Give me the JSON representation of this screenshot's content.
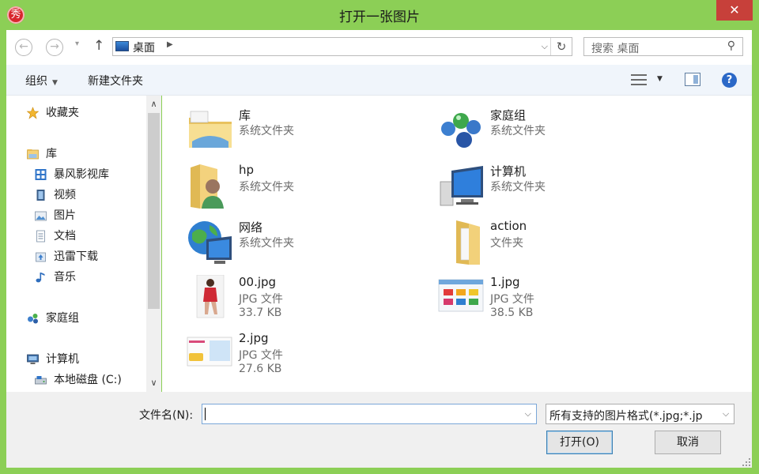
{
  "window": {
    "title": "打开一张图片",
    "close_glyph": "✕",
    "app_icon_glyph": "秀",
    "accent": "#8ccf56"
  },
  "nav": {
    "back": "←",
    "forward": "→",
    "history": "▾",
    "up": "↑",
    "address": "桌面",
    "address_sep": "▶",
    "address_drop": "⌵",
    "refresh": "↻",
    "search_placeholder": "搜索 桌面",
    "search_icon": "⚲"
  },
  "toolbar": {
    "organize": "组织",
    "organize_arrow": "▼",
    "new_folder": "新建文件夹",
    "view_arrow": "▼",
    "help": "?"
  },
  "sidebar": {
    "favorites": "收藏夹",
    "library": "库",
    "library_items": [
      "暴风影视库",
      "视频",
      "图片",
      "文档",
      "迅雷下载",
      "音乐"
    ],
    "homegroup": "家庭组",
    "computer": "计算机",
    "computer_items": [
      "本地磁盘 (C:)"
    ],
    "scroll_up": "∧",
    "scroll_down": "∨"
  },
  "items": [
    {
      "name": "库",
      "line2": "系统文件夹",
      "line3": "",
      "icon": "library-icon"
    },
    {
      "name": "家庭组",
      "line2": "系统文件夹",
      "line3": "",
      "icon": "homegroup-icon"
    },
    {
      "name": "hp",
      "line2": "系统文件夹",
      "line3": "",
      "icon": "user-folder-icon"
    },
    {
      "name": "计算机",
      "line2": "系统文件夹",
      "line3": "",
      "icon": "computer-icon"
    },
    {
      "name": "网络",
      "line2": "系统文件夹",
      "line3": "",
      "icon": "network-icon"
    },
    {
      "name": "action",
      "line2": "文件夹",
      "line3": "",
      "icon": "folder-icon"
    },
    {
      "name": "00.jpg",
      "line2": "JPG 文件",
      "line3": "33.7 KB",
      "icon": "image-thumbnail"
    },
    {
      "name": "1.jpg",
      "line2": "JPG 文件",
      "line3": "38.5 KB",
      "icon": "image-thumbnail"
    },
    {
      "name": "2.jpg",
      "line2": "JPG 文件",
      "line3": "27.6 KB",
      "icon": "image-thumbnail"
    }
  ],
  "footer": {
    "filename_label": "文件名(N):",
    "filename_value": "",
    "filename_drop": "⌵",
    "filetype_value": "所有支持的图片格式(*.jpg;*.jp",
    "filetype_drop": "⌵",
    "open_button": "打开(O)",
    "cancel_button": "取消"
  }
}
